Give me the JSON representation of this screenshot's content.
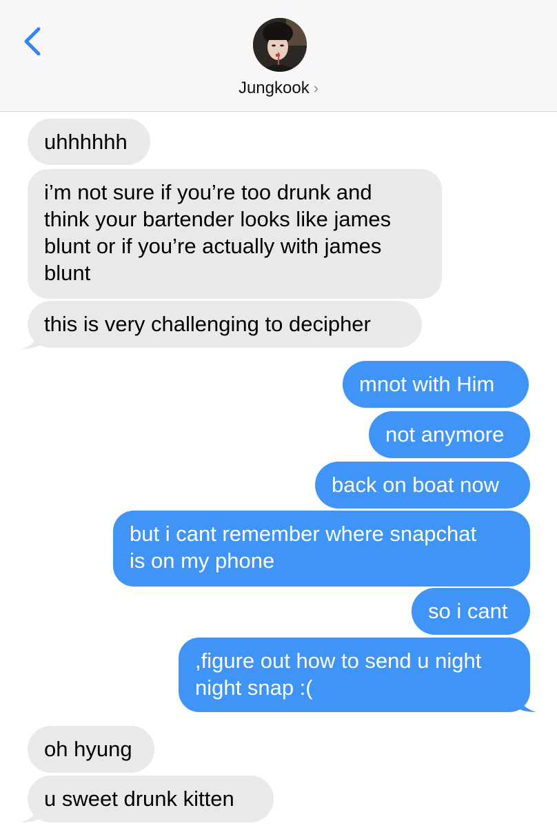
{
  "header": {
    "contact_name": "Jungkook",
    "chevron": "›",
    "back_icon": "chevron-left-icon"
  },
  "colors": {
    "sent_bubble": "#3f94f5",
    "received_bubble": "#e9e9eb",
    "accent": "#2f86f6"
  },
  "messages": [
    {
      "side": "received",
      "lines": [
        "uhhhhhh"
      ]
    },
    {
      "side": "received",
      "lines": [
        "i’m not sure if you’re too drunk and",
        "think your bartender looks like james",
        "blunt or if you’re actually with james",
        "blunt"
      ]
    },
    {
      "side": "received",
      "lines": [
        "this is very challenging to decipher"
      ]
    },
    {
      "side": "sent",
      "lines": [
        "mnot with Him"
      ]
    },
    {
      "side": "sent",
      "lines": [
        "not anymore"
      ]
    },
    {
      "side": "sent",
      "lines": [
        "back on boat now"
      ]
    },
    {
      "side": "sent",
      "lines": [
        "but i cant remember where snapchat",
        "is on my phone"
      ]
    },
    {
      "side": "sent",
      "lines": [
        "so i cant"
      ]
    },
    {
      "side": "sent",
      "lines": [
        ",figure out how to send u night",
        "night snap :("
      ]
    },
    {
      "side": "received",
      "lines": [
        "oh hyung"
      ]
    },
    {
      "side": "received",
      "lines": [
        "u sweet drunk kitten"
      ]
    }
  ]
}
